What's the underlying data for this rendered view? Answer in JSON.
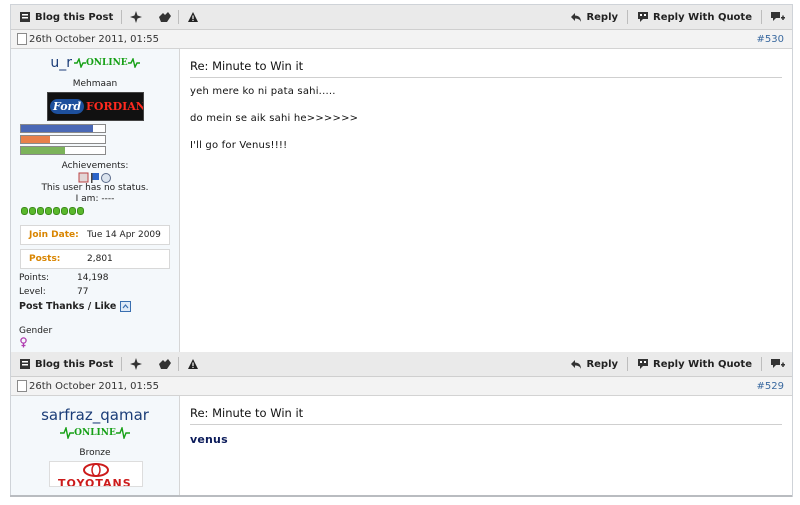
{
  "toolbar": {
    "blog_label": "Blog this Post",
    "reply_label": "Reply",
    "reply_quote_label": "Reply With Quote"
  },
  "posts": [
    {
      "date": "26th October 2011, 01:55",
      "number": "#530",
      "user": {
        "name": "u_r",
        "online_text": "ONLINE",
        "rank": "Mehmaan",
        "banner_text": "FORDIANS",
        "banner_logo": "Ford",
        "achievements_label": "Achievements:",
        "status_text": "This user has no status.",
        "i_am": "I am: ----",
        "join_label": "Join Date:",
        "join_value": "Tue 14 Apr 2009",
        "posts_label": "Posts:",
        "posts_value": "2,801",
        "points_label": "Points:",
        "points_value": "14,198",
        "level_label": "Level:",
        "level_value": "77",
        "thanks_label": "Post Thanks / Like",
        "gender_label": "Gender",
        "bars": [
          0.86,
          0.35,
          0.52
        ]
      },
      "title": "Re: Minute to Win it",
      "messages": [
        "yeh mere ko ni pata sahi.....",
        "do mein se aik sahi he>>>>>>",
        "I'll go for Venus!!!!"
      ]
    },
    {
      "date": "26th October 2011, 01:55",
      "number": "#529",
      "user": {
        "name": "sarfraz_qamar",
        "online_text": "ONLINE",
        "rank": "Bronze",
        "banner_text": "TOYOTANS"
      },
      "title": "Re: Minute to Win it",
      "messages": [
        "venus"
      ]
    }
  ],
  "colors": {
    "toolbar_bg": "#eaeaea",
    "userinfo_bg": "#f4f8fb",
    "accent": "#1b3d78",
    "online": "#16a016",
    "label_orange": "#d98500"
  },
  "icons": [
    "blog-icon",
    "star-icon",
    "thanks-icon",
    "warning-icon",
    "reply-icon",
    "quote-icon",
    "multiquote-icon"
  ]
}
